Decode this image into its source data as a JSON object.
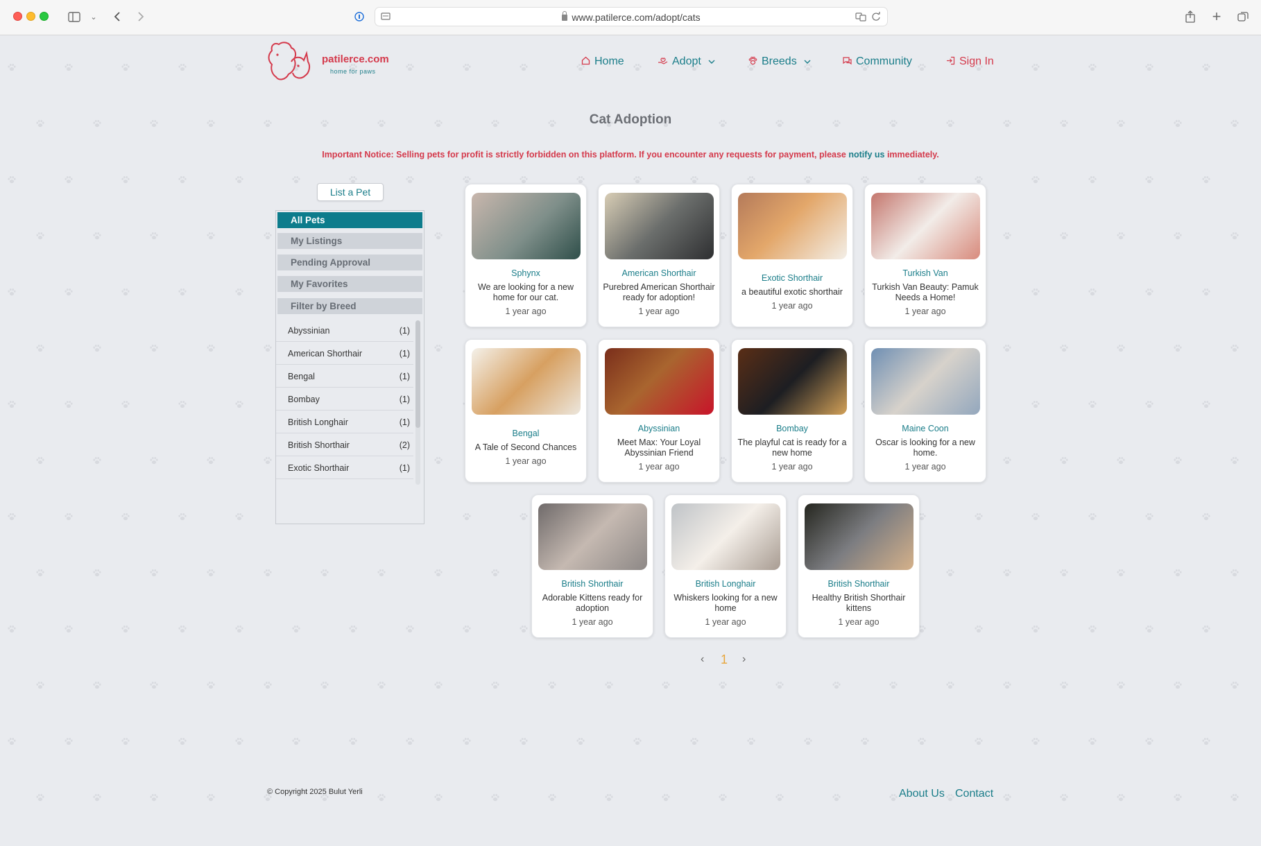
{
  "browser": {
    "url": "www.patilerce.com/adopt/cats"
  },
  "site": {
    "name": "patilerce.com",
    "tagline": "home for paws"
  },
  "nav": {
    "home": "Home",
    "adopt": "Adopt",
    "breeds": "Breeds",
    "community": "Community",
    "signin": "Sign In"
  },
  "page": {
    "title": "Cat Adoption",
    "notice_pre": "Important Notice: Selling pets for profit is strictly forbidden on this platform. If you encounter any requests for payment, please",
    "notice_link": "notify us",
    "notice_post": "immediately."
  },
  "sidebar": {
    "list_button": "List a Pet",
    "tabs": [
      "All Pets",
      "My Listings",
      "Pending Approval",
      "My Favorites",
      "Filter by Breed"
    ],
    "breeds": [
      {
        "name": "Abyssinian",
        "count": "(1)"
      },
      {
        "name": "American Shorthair",
        "count": "(1)"
      },
      {
        "name": "Bengal",
        "count": "(1)"
      },
      {
        "name": "Bombay",
        "count": "(1)"
      },
      {
        "name": "British Longhair",
        "count": "(1)"
      },
      {
        "name": "British Shorthair",
        "count": "(2)"
      },
      {
        "name": "Exotic Shorthair",
        "count": "(1)"
      }
    ]
  },
  "cards": [
    {
      "breed": "Sphynx",
      "desc": "We are looking for a new home for our cat.",
      "time": "1 year ago"
    },
    {
      "breed": "American Shorthair",
      "desc": "Purebred American Shorthair ready for adoption!",
      "time": "1 year ago"
    },
    {
      "breed": "Exotic Shorthair",
      "desc": "a beautiful exotic shorthair",
      "time": "1 year ago"
    },
    {
      "breed": "Turkish Van",
      "desc": "Turkish Van Beauty: Pamuk Needs a Home!",
      "time": "1 year ago"
    },
    {
      "breed": "Bengal",
      "desc": "A Tale of Second Chances",
      "time": "1 year ago"
    },
    {
      "breed": "Abyssinian",
      "desc": "Meet Max: Your Loyal Abyssinian Friend",
      "time": "1 year ago"
    },
    {
      "breed": "Bombay",
      "desc": "The playful cat is ready for a new home",
      "time": "1 year ago"
    },
    {
      "breed": "Maine Coon",
      "desc": "Oscar is looking for a new home.",
      "time": "1 year ago"
    },
    {
      "breed": "British Shorthair",
      "desc": "Adorable Kittens ready for adoption",
      "time": "1 year ago"
    },
    {
      "breed": "British Longhair",
      "desc": "Whiskers looking for a new home",
      "time": "1 year ago"
    },
    {
      "breed": "British Shorthair",
      "desc": "Healthy British Shorthair kittens",
      "time": "1 year ago"
    }
  ],
  "pagination": {
    "prev": "‹",
    "current": "1",
    "next": "›"
  },
  "footer": {
    "copyright": "© Copyright 2025 Bulut Yerli",
    "about": "About Us",
    "contact": "Contact"
  },
  "colors": {
    "brand_teal": "#1a7d89",
    "brand_red": "#d4394b",
    "active_tab": "#0d7c8c",
    "page_number": "#e8a53a"
  }
}
